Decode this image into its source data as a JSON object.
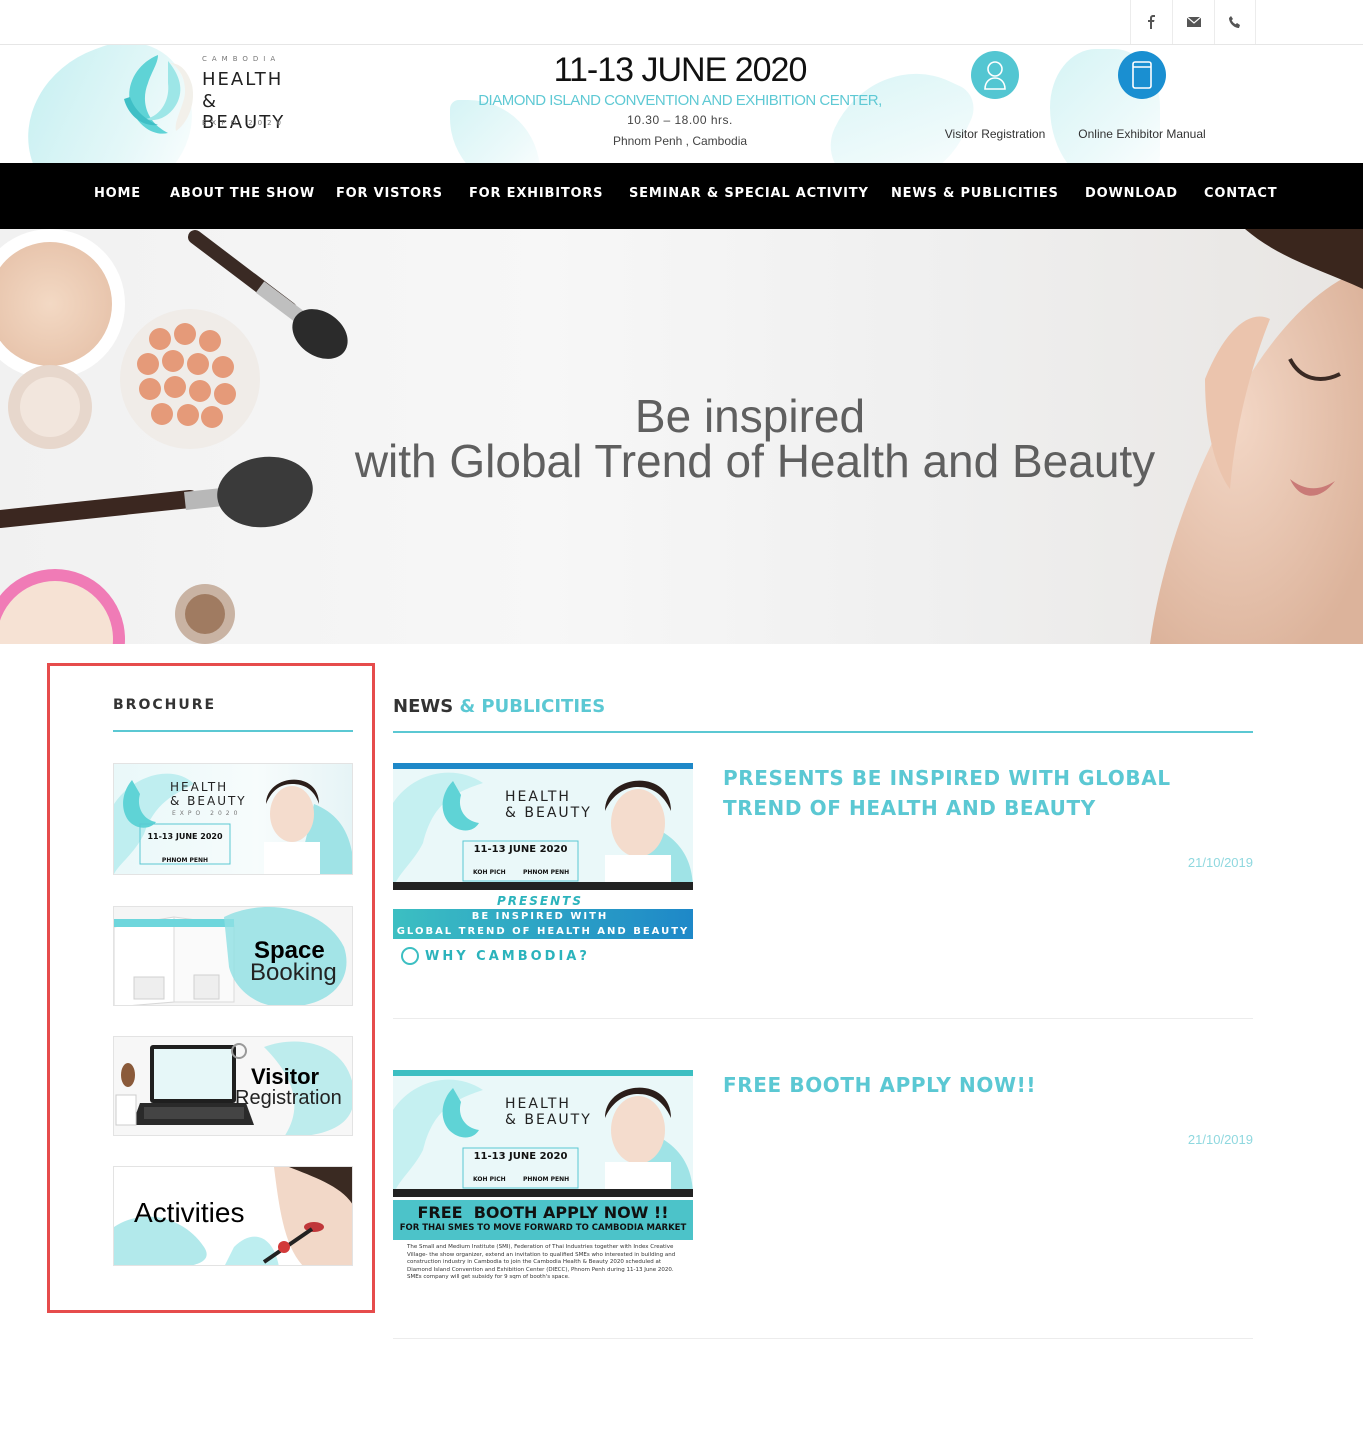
{
  "topbar": {
    "icons": [
      "facebook-icon",
      "mail-icon",
      "phone-icon"
    ]
  },
  "header": {
    "logo": {
      "country": "CAMBODIA",
      "line1": "HEALTH",
      "line2": "& BEAUTY",
      "line3": "EXPO 2020"
    },
    "event": {
      "date": "11-13 JUNE 2020",
      "venue": "DIAMOND ISLAND CONVENTION AND EXHIBITION CENTER,",
      "hours": "10.30 – 18.00 hrs.",
      "city": "Phnom Penh , Cambodia"
    },
    "visitor_registration": "Visitor Registration",
    "exhibitor_manual": "Online Exhibitor Manual"
  },
  "nav": {
    "items": [
      "HOME",
      "ABOUT THE SHOW",
      "FOR VISTORS",
      "FOR EXHIBITORS",
      "SEMINAR & SPECIAL ACTIVITY",
      "NEWS & PUBLICITIES",
      "DOWNLOAD",
      "CONTACT"
    ]
  },
  "hero": {
    "line1": "Be inspired",
    "line2": "with Global Trend of Health and Beauty"
  },
  "sidebar": {
    "title": "BROCHURE",
    "brochure": {
      "line1": "HEALTH",
      "line2": "& BEAUTY",
      "line3": "EXPO 2020",
      "date": "11-13 JUNE 2020",
      "city": "PHNOM PENH"
    },
    "space_booking": {
      "line1": "Space",
      "line2": "Booking"
    },
    "visitor_registration": {
      "line1": "Visitor",
      "line2": "Registration"
    },
    "activities": "Activities"
  },
  "news": {
    "title_a": "NEWS",
    "title_b": "& PUBLICITIES",
    "posts": [
      {
        "title": "PRESENTS BE INSPIRED WITH GLOBAL TREND OF HEALTH AND BEAUTY",
        "date": "21/10/2019",
        "thumb": {
          "line1": "HEALTH",
          "line2": "& BEAUTY",
          "date": "11-13 JUNE 2020",
          "loc1": "KOH PICH",
          "loc2": "PHNOM PENH",
          "presents": "PRESENTS",
          "band1": "BE INSPIRED WITH",
          "band2": "GLOBAL TREND OF HEALTH AND BEAUTY",
          "why": "WHY CAMBODIA?"
        }
      },
      {
        "title": "FREE BOOTH APPLY NOW!!",
        "date": "21/10/2019",
        "thumb": {
          "line1": "HEALTH",
          "line2": "& BEAUTY",
          "date": "11-13 JUNE 2020",
          "loc1": "KOH PICH",
          "loc2": "PHNOM PENH",
          "cta": "FREE  BOOTH APPLY NOW !!",
          "sub": "FOR THAI SMES TO MOVE FORWARD TO CAMBODIA MARKET",
          "body": "The Small and Medium Institute (SMI), Federation of Thai Industries together with Index Creative Village- the show organizer, extend an invitation to qualified SMEs who interested in building and construction industry in Cambodia to join the Cambodia Health & Beauty 2020 scheduled at Diamond Island Convention and Exhibition Center (DIECC), Phnom Penh during 11-13 June 2020. SMEs company will get subsidy for 9 sqm of booth's space."
        }
      }
    ]
  },
  "colors": {
    "accent": "#5bc8d3",
    "nav_bg": "#000000",
    "highlight_border": "#e64c4c",
    "icon_blue": "#1a8fd1"
  }
}
